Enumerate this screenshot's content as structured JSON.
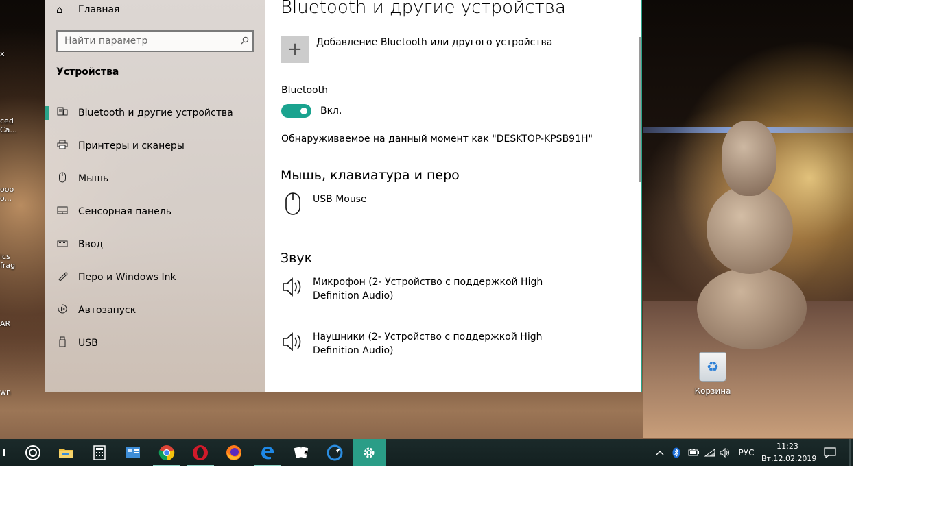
{
  "window": {
    "nav": {
      "home_label": "Главная",
      "search_placeholder": "Найти параметр",
      "section_title": "Устройства",
      "items": [
        {
          "label": "Bluetooth и другие устройства",
          "icon": "devices-icon"
        },
        {
          "label": "Принтеры и сканеры",
          "icon": "printer-icon"
        },
        {
          "label": "Мышь",
          "icon": "mouse-icon"
        },
        {
          "label": "Сенсорная панель",
          "icon": "touchpad-icon"
        },
        {
          "label": "Ввод",
          "icon": "keyboard-icon"
        },
        {
          "label": "Перо и Windows Ink",
          "icon": "pen-icon"
        },
        {
          "label": "Автозапуск",
          "icon": "autoplay-icon"
        },
        {
          "label": "USB",
          "icon": "usb-icon"
        }
      ]
    },
    "content": {
      "title": "Bluetooth и другие устройства",
      "add_device_label": "Добавление Bluetooth или другого устройства",
      "bluetooth_label": "Bluetooth",
      "toggle_state": "Вкл.",
      "toggle_on": true,
      "discoverable_text": "Обнаруживаемое на данный момент как \"DESKTOP-KPSB91H\"",
      "mouse_section": {
        "title": "Мышь, клавиатура и перо",
        "devices": [
          {
            "name": "USB Mouse",
            "icon": "mouse-icon"
          }
        ]
      },
      "sound_section": {
        "title": "Звук",
        "devices": [
          {
            "name": "Микрофон (2- Устройство с поддержкой High Definition Audio)",
            "icon": "speaker-icon"
          },
          {
            "name": "Наушники (2- Устройство с поддержкой High Definition Audio)",
            "icon": "speaker-icon"
          }
        ]
      }
    }
  },
  "desktop": {
    "recycle_bin_label": "Корзина",
    "left_shortcut_fragments": [
      "x",
      "ced\nCa...",
      "ooo\no...",
      "ics\nfrag",
      "AR",
      "wn"
    ]
  },
  "taskbar": {
    "apps": [
      "start-icon",
      "cortana-icon",
      "file-explorer-icon",
      "calculator-icon",
      "control-panel-icon",
      "chrome-icon",
      "opera-icon",
      "firefox-icon",
      "edge-icon",
      "solitaire-icon",
      "ccleaner-icon",
      "settings-icon"
    ],
    "active_app": "settings-icon",
    "language": "РУС",
    "time": "11:23",
    "date": "Вт.12.02.2019"
  },
  "colors": {
    "accent": "#2aa48a",
    "toggle_on": "#1aa38f",
    "taskbar": "#162525"
  }
}
